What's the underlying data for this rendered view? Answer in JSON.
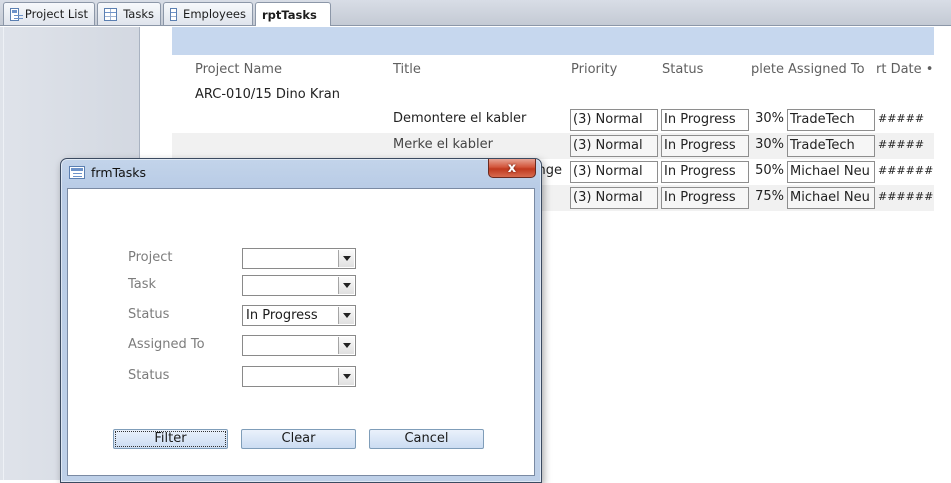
{
  "tabs": [
    {
      "label": "Project List",
      "icon": "form-icon"
    },
    {
      "label": "Tasks",
      "icon": "table-icon"
    },
    {
      "label": "Employees",
      "icon": "table-icon"
    },
    {
      "label": "rptTasks",
      "icon": "report-icon",
      "active": true
    }
  ],
  "report": {
    "columns": {
      "project_name": "Project Name",
      "title": "Title",
      "priority": "Priority",
      "status": "Status",
      "complete": "plete",
      "assigned_to": "Assigned To",
      "start_date": "rt Date •"
    },
    "group": "ARC-010/15 Dino Kran",
    "rows": [
      {
        "title": "Demontere el kabler",
        "priority": "(3) Normal",
        "status": "In Progress",
        "complete": "30%",
        "assigned_to": "TradeTech",
        "start_date": "#####"
      },
      {
        "title": "Merke el kabler",
        "priority": "(3) Normal",
        "status": "In Progress",
        "complete": "30%",
        "assigned_to": "TradeTech",
        "start_date": "#####"
      },
      {
        "title": "nge",
        "priority": "(3) Normal",
        "status": "In Progress",
        "complete": "50%",
        "assigned_to": "Michael Neu",
        "start_date": "###### !"
      },
      {
        "title": "",
        "priority": "(3) Normal",
        "status": "In Progress",
        "complete": "75%",
        "assigned_to": "Michael Neu",
        "start_date": "###### !"
      }
    ]
  },
  "dialog": {
    "title": "frmTasks",
    "close_label": "x",
    "fields": [
      {
        "label": "Project",
        "value": ""
      },
      {
        "label": "Task",
        "value": ""
      },
      {
        "label": "Status",
        "value": "In Progress"
      },
      {
        "label": "Assigned To",
        "value": ""
      },
      {
        "label": "Status",
        "value": ""
      }
    ],
    "buttons": {
      "filter": "Filter",
      "clear": "Clear",
      "cancel": "Cancel"
    }
  }
}
